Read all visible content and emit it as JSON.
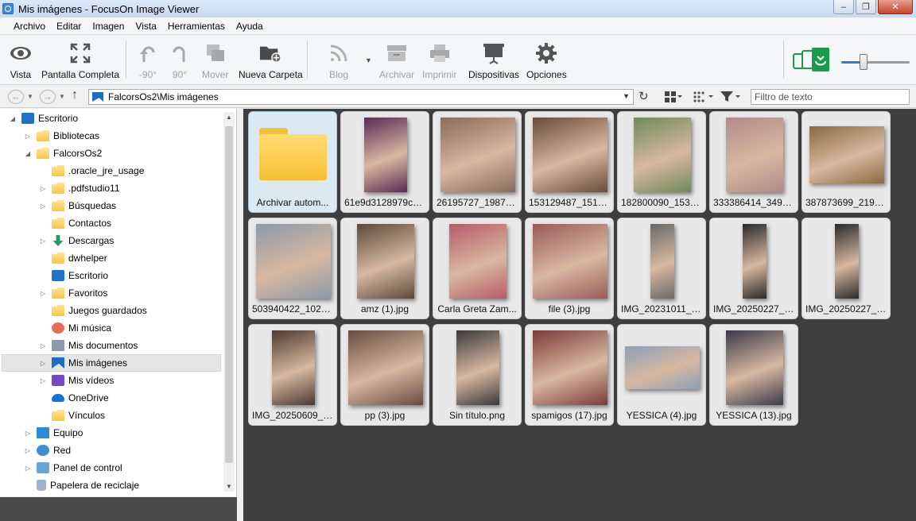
{
  "window": {
    "title": "Mis imágenes - FocusOn Image Viewer",
    "min": "–",
    "max": "❐",
    "close": "✕"
  },
  "menu": [
    "Archivo",
    "Editar",
    "Imagen",
    "Vista",
    "Herramientas",
    "Ayuda"
  ],
  "toolbar": {
    "vista": "Vista",
    "pantalla": "Pantalla Completa",
    "rot_left": "-90°",
    "rot_right": "90°",
    "mover": "Mover",
    "nueva_carpeta": "Nueva Carpeta",
    "blog": "Blog",
    "archivar": "Archivar",
    "imprimir": "Imprimir",
    "dispositivas": "Dispositivas",
    "opciones": "Opciones"
  },
  "zoom_slider": {
    "value_fraction": 0.32
  },
  "address": {
    "path": "FalcorsOs2\\Mis imágenes",
    "filter_placeholder": "Filtro de texto"
  },
  "tree": [
    {
      "label": "Escritorio",
      "icon": "desktop",
      "level": 0,
      "expander": "◢"
    },
    {
      "label": "Bibliotecas",
      "icon": "folder",
      "level": 1,
      "expander": "▷"
    },
    {
      "label": "FalcorsOs2",
      "icon": "folder",
      "level": 1,
      "expander": "◢"
    },
    {
      "label": ".oracle_jre_usage",
      "icon": "folder",
      "level": 2,
      "expander": ""
    },
    {
      "label": ".pdfstudio11",
      "icon": "folder",
      "level": 2,
      "expander": "▷"
    },
    {
      "label": "Búsquedas",
      "icon": "folder",
      "level": 2,
      "expander": "▷"
    },
    {
      "label": "Contactos",
      "icon": "folder",
      "level": 2,
      "expander": ""
    },
    {
      "label": "Descargas",
      "icon": "download",
      "level": 2,
      "expander": "▷"
    },
    {
      "label": "dwhelper",
      "icon": "folder",
      "level": 2,
      "expander": ""
    },
    {
      "label": "Escritorio",
      "icon": "desktop",
      "level": 2,
      "expander": ""
    },
    {
      "label": "Favoritos",
      "icon": "folder",
      "level": 2,
      "expander": "▷"
    },
    {
      "label": "Juegos guardados",
      "icon": "folder",
      "level": 2,
      "expander": ""
    },
    {
      "label": "Mi música",
      "icon": "music",
      "level": 2,
      "expander": ""
    },
    {
      "label": "Mis documentos",
      "icon": "doc",
      "level": 2,
      "expander": "▷"
    },
    {
      "label": "Mis imágenes",
      "icon": "pictures",
      "level": 2,
      "expander": "▷",
      "selected": true
    },
    {
      "label": "Mis vídeos",
      "icon": "video",
      "level": 2,
      "expander": "▷"
    },
    {
      "label": "OneDrive",
      "icon": "cloud",
      "level": 2,
      "expander": ""
    },
    {
      "label": "Vínculos",
      "icon": "folder",
      "level": 2,
      "expander": ""
    },
    {
      "label": "Equipo",
      "icon": "monitor",
      "level": 1,
      "expander": "▷"
    },
    {
      "label": "Red",
      "icon": "network",
      "level": 1,
      "expander": "▷"
    },
    {
      "label": "Panel de control",
      "icon": "panel",
      "level": 1,
      "expander": "▷"
    },
    {
      "label": "Papelera de reciclaje",
      "icon": "bin",
      "level": 1,
      "expander": ""
    }
  ],
  "thumbnails": [
    {
      "caption": "Archivar autom...",
      "kind": "folder",
      "selected": true
    },
    {
      "caption": "61e9d3128979c7...",
      "kind": "portrait",
      "color": "#5a2a55"
    },
    {
      "caption": "26195727_19871...",
      "kind": "landscape-tall",
      "color": "#8a6a5a"
    },
    {
      "caption": "153129487_1510...",
      "kind": "landscape-tall",
      "color": "#6a4a3a"
    },
    {
      "caption": "182800090_1534...",
      "kind": "portrait-wide",
      "color": "#6f8a5a"
    },
    {
      "caption": "333386414_3491...",
      "kind": "portrait-wide",
      "color": "#b08a8a"
    },
    {
      "caption": "387873699_2195...",
      "kind": "landscape",
      "color": "#8a6a40"
    },
    {
      "caption": "503940422_1022...",
      "kind": "landscape-tall",
      "color": "#8a9aa8"
    },
    {
      "caption": "amz (1).jpg",
      "kind": "portrait-wide",
      "color": "#5a4a3a"
    },
    {
      "caption": "Carla Greta Zam...",
      "kind": "portrait-wide",
      "color": "#b85a6a"
    },
    {
      "caption": "file (3).jpg",
      "kind": "landscape-tall",
      "color": "#9a5a5a"
    },
    {
      "caption": "IMG_20231011_0...",
      "kind": "portrait-thin",
      "color": "#6a6a6a"
    },
    {
      "caption": "IMG_20250227_2...",
      "kind": "portrait-thin",
      "color": "#2a2a2a"
    },
    {
      "caption": "IMG_20250227_2...",
      "kind": "portrait-thin",
      "color": "#2a2a2a"
    },
    {
      "caption": "IMG_20250609_1...",
      "kind": "portrait",
      "color": "#4a3a30"
    },
    {
      "caption": "pp (3).jpg",
      "kind": "landscape-tall",
      "color": "#6a4a40"
    },
    {
      "caption": "Sin título.png",
      "kind": "portrait",
      "color": "#3a3a3a"
    },
    {
      "caption": "spamigos (17).jpg",
      "kind": "landscape-tall",
      "color": "#7a3a3a"
    },
    {
      "caption": "YESSICA (4).jpg",
      "kind": "landscape-wide",
      "color": "#8aa0b8"
    },
    {
      "caption": "YESSICA (13).jpg",
      "kind": "portrait-wide",
      "color": "#3a3a4a"
    }
  ]
}
